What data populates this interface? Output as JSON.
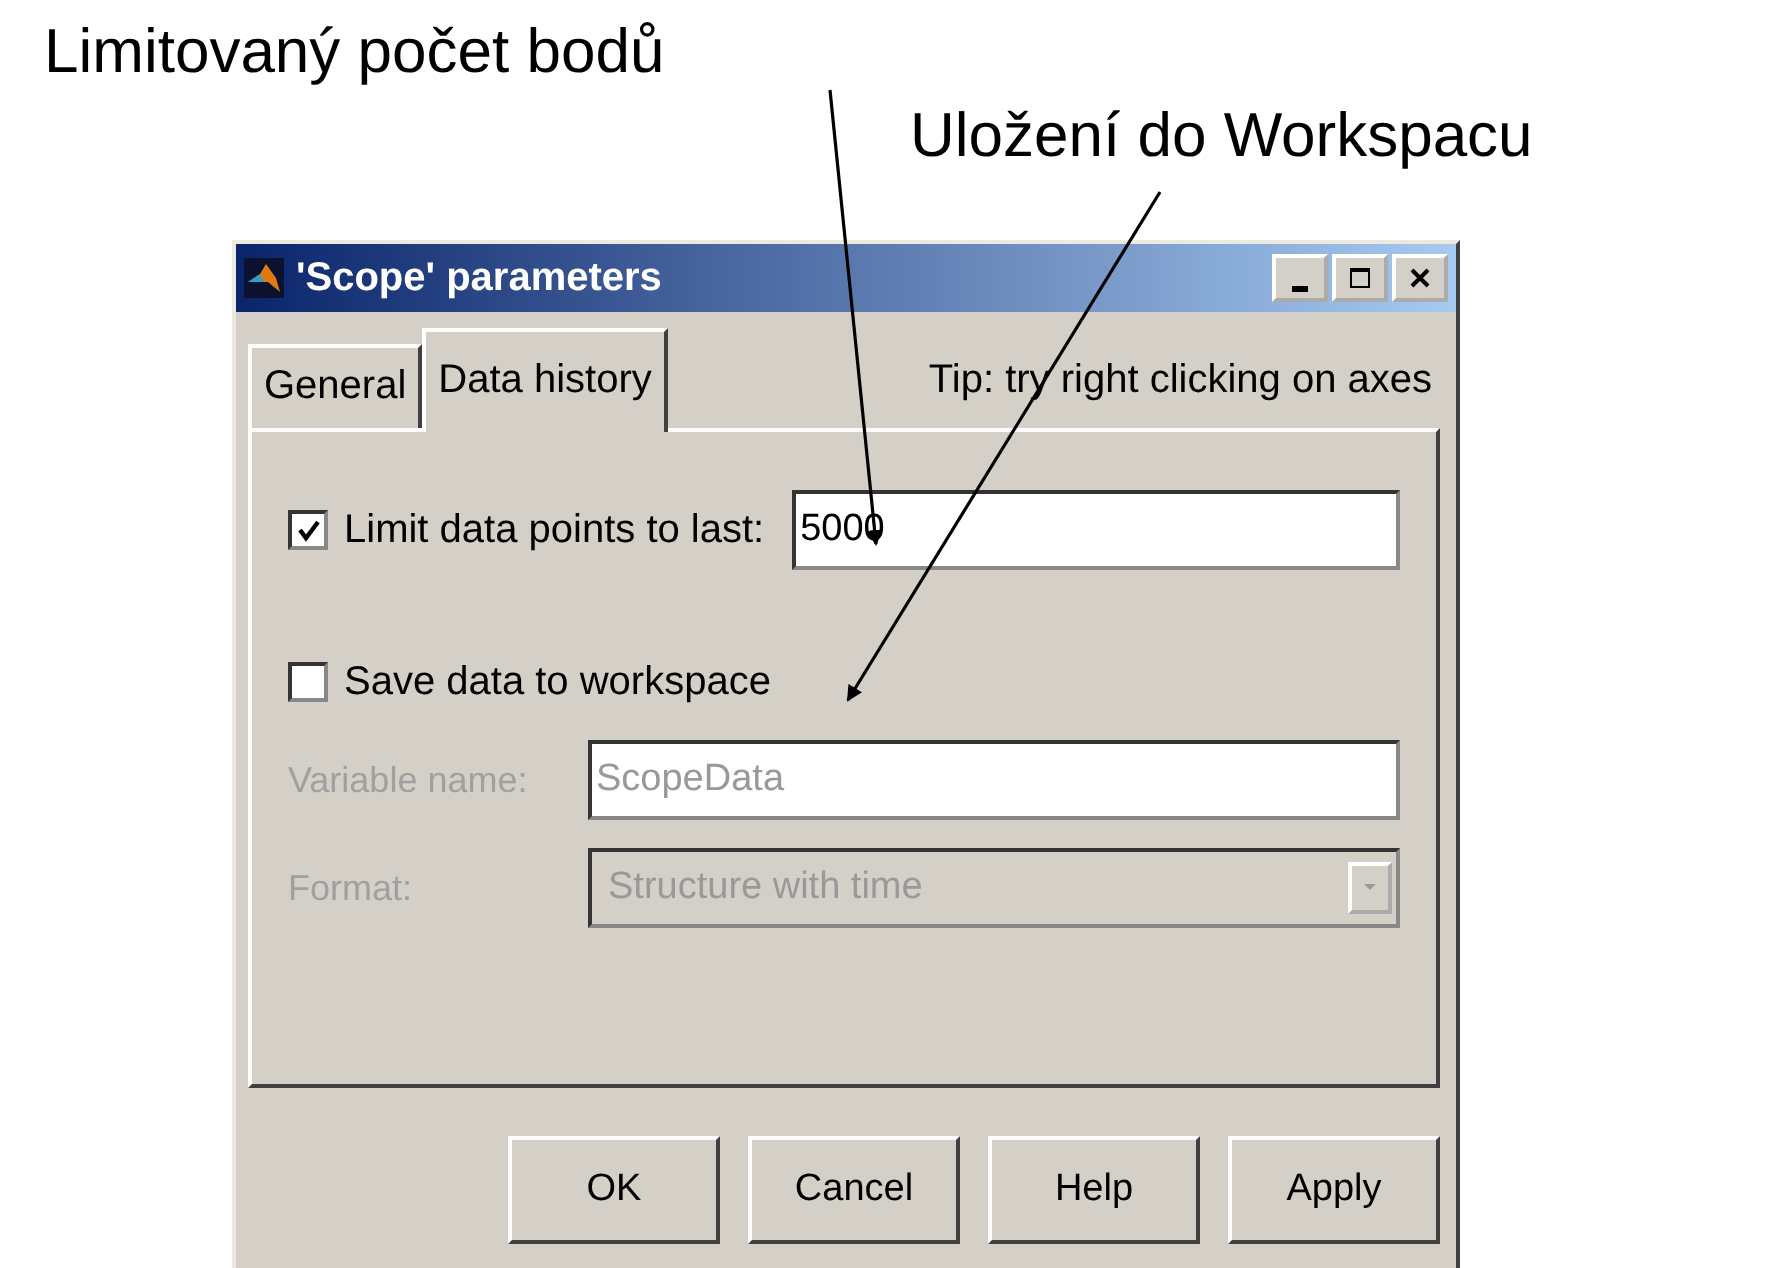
{
  "annotations": [
    {
      "text": "Limitovaný počet bodů"
    },
    {
      "text": "Uložení do Workspacu"
    }
  ],
  "window": {
    "title": "'Scope' parameters"
  },
  "tabs": [
    {
      "label": "General",
      "selected": false
    },
    {
      "label": "Data history",
      "selected": true
    }
  ],
  "tip": "Tip: try right clicking on axes",
  "limit": {
    "label": "Limit data points to last:",
    "checked": true,
    "value": "5000"
  },
  "save": {
    "label": "Save data to workspace",
    "checked": false
  },
  "variable": {
    "label": "Variable name:",
    "value": "ScopeData",
    "disabled": true
  },
  "format": {
    "label": "Format:",
    "value": "Structure with time",
    "disabled": true
  },
  "buttons": [
    "OK",
    "Cancel",
    "Help",
    "Apply"
  ]
}
